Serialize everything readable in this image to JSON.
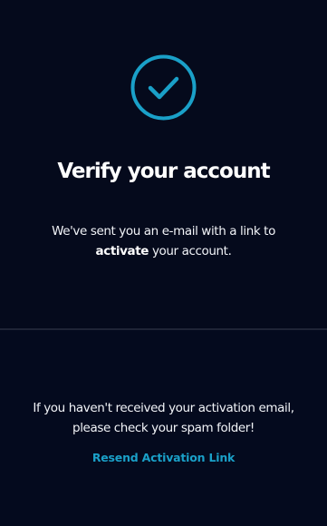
{
  "verify": {
    "title": "Verify your account",
    "message_before": "We've sent you an e-mail with a link to ",
    "message_strong": "activate",
    "message_after": " your account."
  },
  "help": {
    "note": "If you haven't received your activation email, please check your spam folder!",
    "resend_label": "Resend Activation Link"
  },
  "icons": {
    "status": "check-circle-icon"
  },
  "colors": {
    "background": "#050a1c",
    "accent": "#1aa0c8",
    "text": "#ffffff",
    "divider": "#1f2436"
  }
}
